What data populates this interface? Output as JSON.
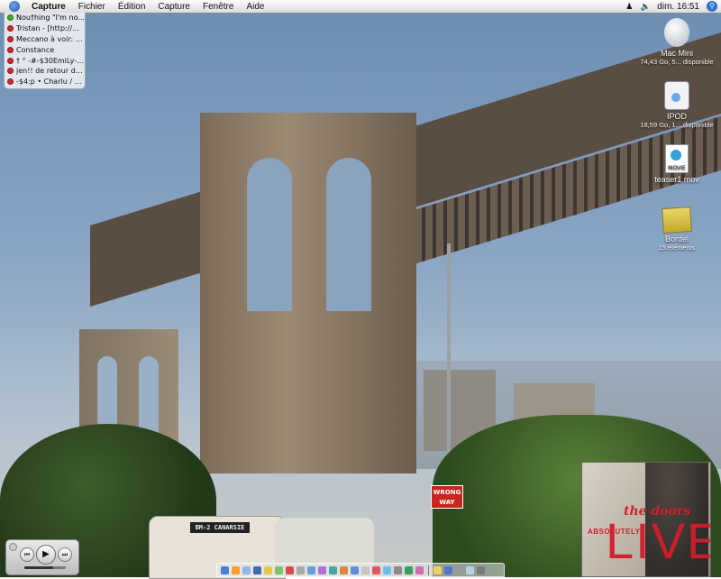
{
  "menubar": {
    "apple_icon": "apple-logo-icon",
    "items": [
      {
        "label": "Capture",
        "bold": true
      },
      {
        "label": "Fichier"
      },
      {
        "label": "Édition"
      },
      {
        "label": "Capture"
      },
      {
        "label": "Fenêtre"
      },
      {
        "label": "Aide"
      }
    ],
    "clock": "dim. 16:51",
    "status_icons": [
      "user-icon",
      "volume-icon",
      "spotlight-icon"
    ]
  },
  "chat_list": {
    "contacts": [
      {
        "status": "available",
        "color": "#3fae2a",
        "text": "Nou†hing \"I'm no..."
      },
      {
        "status": "away",
        "color": "#d4262b",
        "text": "Tristan  - [http://..."
      },
      {
        "status": "away",
        "color": "#d4262b",
        "text": "Meccano à voir: h..."
      },
      {
        "status": "away",
        "color": "#d4262b",
        "text": "Constance"
      },
      {
        "status": "away",
        "color": "#d4262b",
        "text": "† ° -#-$30EmiLy-$..."
      },
      {
        "status": "away",
        "color": "#d4262b",
        "text": "jen!! de retour de ..."
      },
      {
        "status": "away",
        "color": "#d4262b",
        "text": "-$4:p • Charlu / B..."
      }
    ]
  },
  "desktop_icons": [
    {
      "name": "Mac Mini",
      "sub": "74,43 Go, 5... disponible",
      "icon": "hard-drive-icon"
    },
    {
      "name": "IPOD",
      "sub": "18,59 Go, 1... disponible",
      "icon": "ipod-icon"
    },
    {
      "name": "teaser1.mov",
      "sub": "",
      "icon": "movie-file-icon",
      "badge": "MOVIE"
    },
    {
      "name": "Bordel",
      "sub": "15 éléments",
      "icon": "folder-icon"
    }
  ],
  "album": {
    "band": "the doors",
    "word": "ABSOLUTELY",
    "title": "LIVE"
  },
  "wallpaper": {
    "bus_sign": "BM-2 CANARSIE",
    "road_sign": "WRONG WAY"
  },
  "controller": {
    "prev": "⏮",
    "play": "▶",
    "next": "⏭",
    "volume": 0.7
  },
  "dock": {
    "colors": [
      "#4a7fd1",
      "#ff9d2e",
      "#8fb7e8",
      "#3f6bb0",
      "#e6c84a",
      "#7cc36b",
      "#d94b4b",
      "#a8a8a8",
      "#6a9fd6",
      "#b26fd0",
      "#4aa7a0",
      "#d88a3a",
      "#5d8fd8",
      "#c5c5c5",
      "#e05757",
      "#6cc0e8",
      "#8c8c8c",
      "#3c9d5a",
      "#cf6fb0",
      "#f0d060",
      "#5a6fd1",
      "#999999",
      "#b8d0e8",
      "#7a7a7a"
    ]
  },
  "colors": {
    "menubar": "#e8e8e8",
    "available": "#3fae2a",
    "away": "#d4262b",
    "album_red": "#d21e2a"
  }
}
